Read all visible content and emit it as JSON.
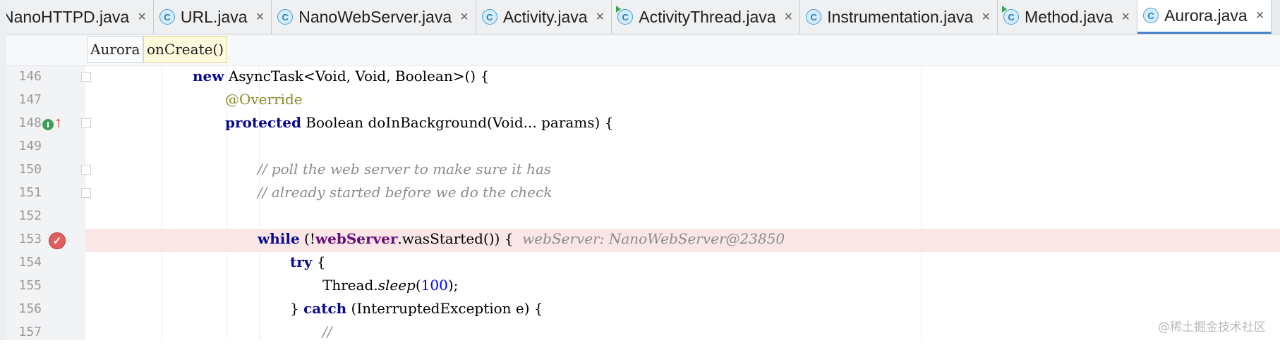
{
  "tabs": [
    {
      "label": "NanoHTTPD.java",
      "active": false,
      "icon": "none"
    },
    {
      "label": "URL.java",
      "active": false,
      "icon": "class-icon"
    },
    {
      "label": "NanoWebServer.java",
      "active": false,
      "icon": "class-icon"
    },
    {
      "label": "Activity.java",
      "active": false,
      "icon": "class-icon"
    },
    {
      "label": "ActivityThread.java",
      "active": false,
      "icon": "runnable-class-icon"
    },
    {
      "label": "Instrumentation.java",
      "active": false,
      "icon": "class-icon"
    },
    {
      "label": "Method.java",
      "active": false,
      "icon": "class-icon"
    },
    {
      "label": "Aurora.java",
      "active": true,
      "icon": "class-icon"
    }
  ],
  "tab_icon_letter": "C",
  "tab_close_glyph": "×",
  "breadcrumb": {
    "class_name": "Aurora",
    "method_name": "onCreate()"
  },
  "gutter": {
    "impl_marker": "I"
  },
  "lines": [
    {
      "n": "146"
    },
    {
      "n": "147"
    },
    {
      "n": "148"
    },
    {
      "n": "149"
    },
    {
      "n": "150"
    },
    {
      "n": "151"
    },
    {
      "n": "152"
    },
    {
      "n": "153"
    },
    {
      "n": "154"
    },
    {
      "n": "155"
    },
    {
      "n": "156"
    },
    {
      "n": "157"
    }
  ],
  "code": {
    "l146": {
      "kw": "new",
      "rest": " AsyncTask<Void, Void, Boolean>() {"
    },
    "l147": {
      "ann": "@Override"
    },
    "l148": {
      "kw": "protected",
      "rest": " Boolean doInBackground(Void... params) {"
    },
    "l150": {
      "cmt": "// poll the web server to make sure it has"
    },
    "l151": {
      "cmt": "// already started before we do the check"
    },
    "l153": {
      "kw": "while",
      "pre": " (!",
      "field": "webServer",
      "rest": ".wasStarted()) {",
      "hint": "webServer: NanoWebServer@23850"
    },
    "l154": {
      "kw": "try",
      "rest": " {"
    },
    "l155": {
      "pre": "Thread.",
      "static": "sleep",
      "open": "(",
      "num": "100",
      "close": ");"
    },
    "l156": {
      "pre": "} ",
      "kw": "catch",
      "rest": " (InterruptedException e) {"
    },
    "l157": {
      "cmt": "//"
    }
  },
  "watermark": "@稀土掘金技术社区",
  "colors": {
    "breakpoint_line": "#fae6e6",
    "breakpoint_icon": "#e35f5f",
    "keyword": "#0a0a8c",
    "comment": "#8c8c8c",
    "annotation": "#8a8a2c",
    "number": "#0000ff",
    "field": "#660e7a"
  }
}
